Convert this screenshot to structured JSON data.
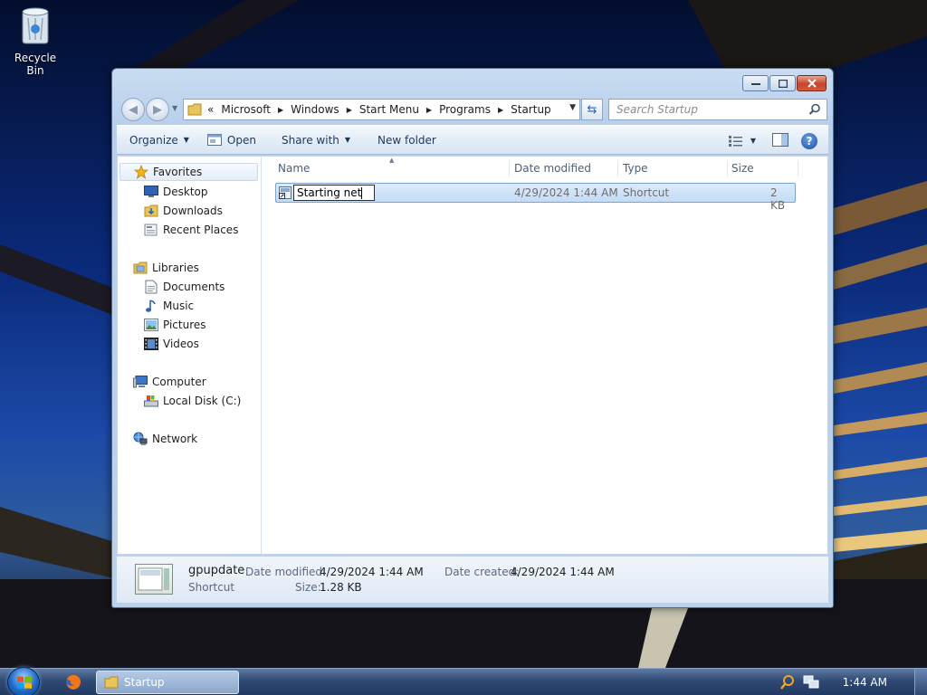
{
  "desktop": {
    "recycle_bin_label": "Recycle Bin"
  },
  "window": {
    "breadcrumb": {
      "overflow": "«",
      "segments": [
        "Microsoft",
        "Windows",
        "Start Menu",
        "Programs",
        "Startup"
      ]
    },
    "search_placeholder": "Search Startup",
    "toolbar": {
      "organize": "Organize",
      "open": "Open",
      "share_with": "Share with",
      "new_folder": "New folder"
    },
    "nav": {
      "favorites": "Favorites",
      "desktop": "Desktop",
      "downloads": "Downloads",
      "recent_places": "Recent Places",
      "libraries": "Libraries",
      "documents": "Documents",
      "music": "Music",
      "pictures": "Pictures",
      "videos": "Videos",
      "computer": "Computer",
      "local_disk": "Local Disk (C:)",
      "network": "Network"
    },
    "columns": {
      "name": "Name",
      "date_modified": "Date modified",
      "type": "Type",
      "size": "Size"
    },
    "file": {
      "rename_value": "Starting net",
      "date_modified": "4/29/2024 1:44 AM",
      "type": "Shortcut",
      "size": "2 KB"
    },
    "details": {
      "name": "gpupdate",
      "type": "Shortcut",
      "date_modified_label": "Date modified:",
      "date_modified": "4/29/2024 1:44 AM",
      "date_created_label": "Date created:",
      "date_created": "4/29/2024 1:44 AM",
      "size_label": "Size:",
      "size": "1.28 KB"
    }
  },
  "taskbar": {
    "active_window": "Startup",
    "clock": "1:44 AM"
  },
  "colors": {
    "accent": "#1e395b",
    "selection": "#c3dcf7"
  }
}
